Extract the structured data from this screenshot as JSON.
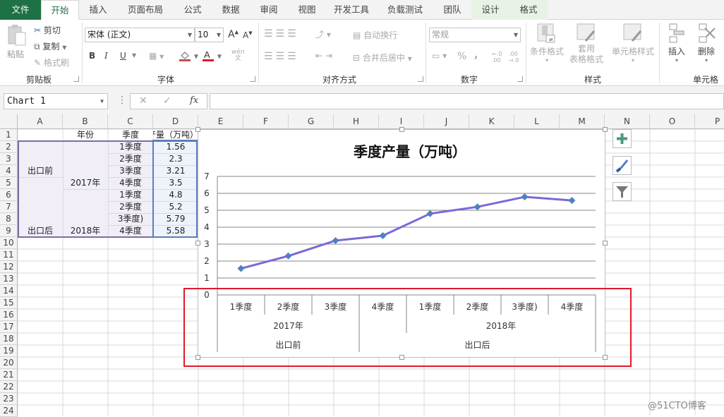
{
  "ribbon_tabs": [
    {
      "label": "文件",
      "type": "file"
    },
    {
      "label": "开始",
      "type": "active"
    },
    {
      "label": "插入"
    },
    {
      "label": "页面布局"
    },
    {
      "label": "公式"
    },
    {
      "label": "数据"
    },
    {
      "label": "审阅"
    },
    {
      "label": "视图"
    },
    {
      "label": "开发工具"
    },
    {
      "label": "负载测试"
    },
    {
      "label": "团队"
    },
    {
      "label": "设计",
      "type": "contextual"
    },
    {
      "label": "格式",
      "type": "contextual"
    }
  ],
  "ribbon": {
    "clipboard": {
      "group": "剪贴板",
      "paste": "粘贴",
      "cut": "剪切",
      "copy": "复制",
      "format_painter": "格式刷"
    },
    "font": {
      "group": "字体",
      "font_name": "宋体 (正文)",
      "font_size": "10",
      "bold": "B",
      "italic": "I",
      "underline": "U",
      "phonetic": "wén"
    },
    "alignment": {
      "group": "对齐方式",
      "wrap_text": "自动换行",
      "merge_center": "合并后居中"
    },
    "number": {
      "group": "数字",
      "format": "常规",
      "percent": "%",
      "comma": ","
    },
    "styles": {
      "group": "样式",
      "conditional": "条件格式",
      "table_format_1": "套用",
      "table_format_2": "表格格式",
      "cell_styles": "单元格样式"
    },
    "cells": {
      "group": "单元格",
      "insert": "插入",
      "delete": "删除"
    }
  },
  "formula_bar": {
    "name_box": "Chart 1",
    "fx": "fx",
    "formula": ""
  },
  "columns": [
    "A",
    "B",
    "C",
    "D",
    "E",
    "F",
    "G",
    "H",
    "I",
    "J",
    "K",
    "L",
    "M",
    "N",
    "O",
    "P"
  ],
  "rows": [
    "1",
    "2",
    "3",
    "4",
    "5",
    "6",
    "7",
    "8",
    "9",
    "10",
    "11",
    "12",
    "13",
    "14",
    "15",
    "16",
    "17",
    "18",
    "19",
    "20",
    "21",
    "22",
    "23",
    "24"
  ],
  "sheet": {
    "headers": {
      "B1": "年份",
      "C1": "季度",
      "D1": "季度产量（万吨）"
    },
    "A_merged": [
      {
        "label": "出口前"
      },
      {
        "label": "出口后"
      }
    ],
    "B_merged": [
      {
        "label": "2017年"
      },
      {
        "label": "2018年"
      }
    ],
    "C": [
      "1季度",
      "2季度",
      "3季度",
      "4季度",
      "1季度",
      "2季度",
      "3季度)",
      "4季度"
    ],
    "D": [
      "1.56",
      "2.3",
      "3.21",
      "3.5",
      "4.8",
      "5.2",
      "5.79",
      "5.58"
    ]
  },
  "chart_data": {
    "type": "line",
    "title": "季度产量（万吨）",
    "categories": [
      "1季度",
      "2季度",
      "3季度",
      "4季度",
      "1季度",
      "2季度",
      "3季度)",
      "4季度"
    ],
    "category_levels": [
      {
        "level": "year",
        "groups": [
          {
            "label": "2017年",
            "span": [
              0,
              2
            ]
          },
          {
            "label": "2018年",
            "span": [
              3,
              7
            ]
          }
        ]
      },
      {
        "level": "export",
        "groups": [
          {
            "label": "出口前",
            "span": [
              0,
              2
            ]
          },
          {
            "label": "出口后",
            "span": [
              3,
              7
            ]
          }
        ]
      }
    ],
    "series": [
      {
        "name": "季度产量（万吨）",
        "values": [
          1.56,
          2.3,
          3.21,
          3.5,
          4.8,
          5.2,
          5.79,
          5.58
        ],
        "color": "#7b68d9",
        "marker_color": "#4f81bd"
      }
    ],
    "yticks": [
      "0",
      "1",
      "2",
      "3",
      "4",
      "5",
      "6",
      "7"
    ],
    "ylim": [
      0,
      7
    ],
    "grid": true,
    "legend": "none"
  },
  "chart_tools": {
    "add": "chart-elements",
    "style": "chart-styles",
    "filter": "chart-filters"
  },
  "colors": {
    "accent": "#1e7145",
    "highlight": "#e0192b",
    "selection": "#7f6ba3"
  },
  "watermark": "@51CTO博客"
}
